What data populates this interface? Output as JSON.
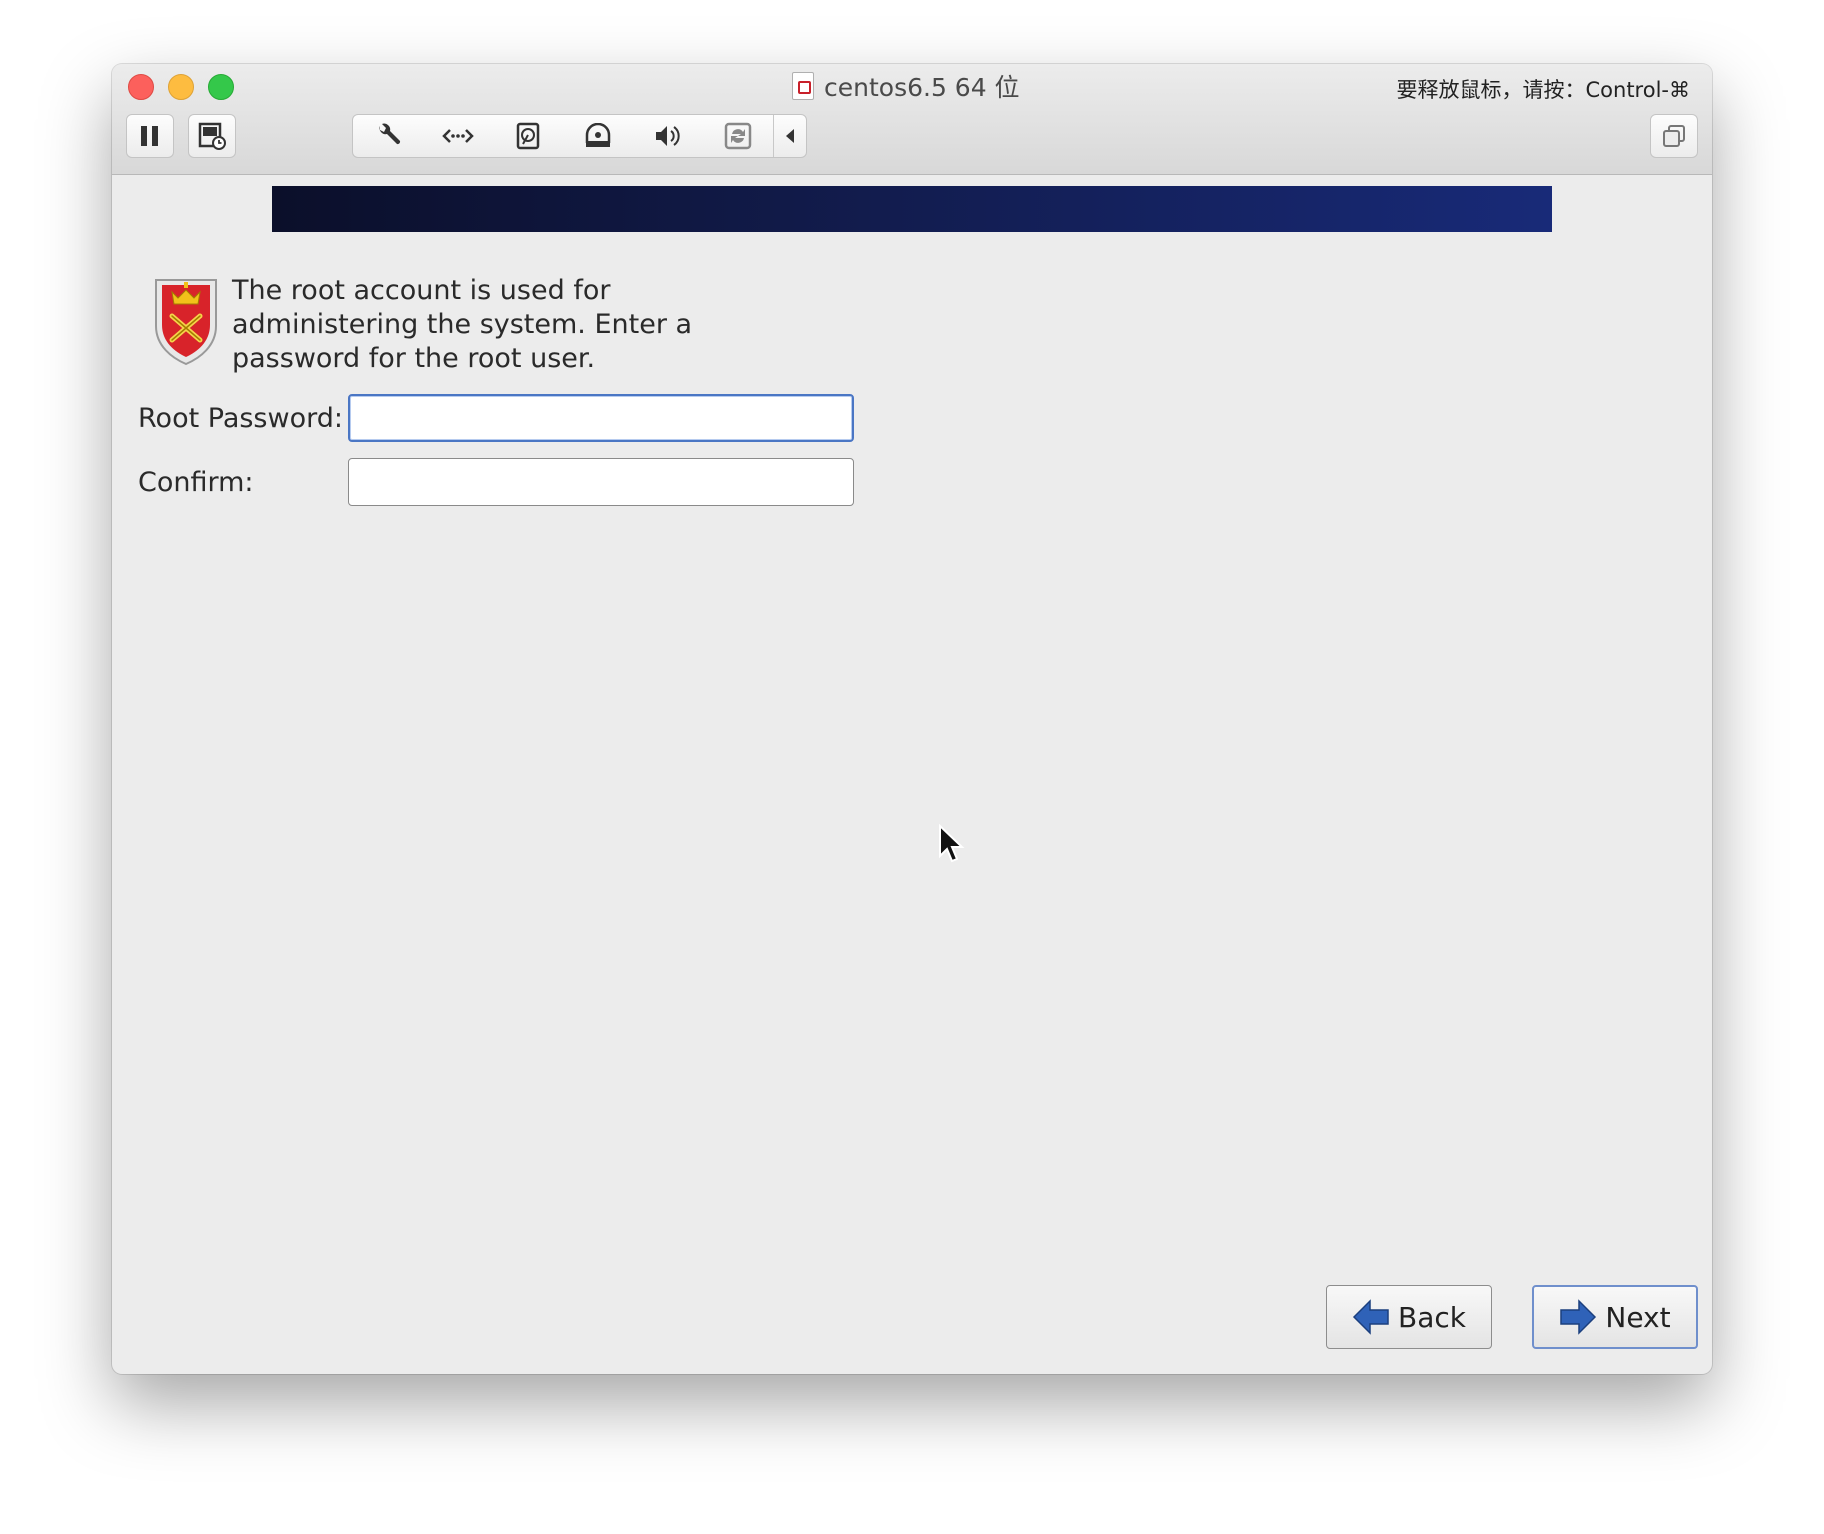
{
  "window": {
    "title": "centos6.5 64 位",
    "release_hint": "要释放鼠标，请按：Control-⌘"
  },
  "toolbar": {
    "icons": [
      "pause-icon",
      "snapshot-icon",
      "settings-wrench-icon",
      "network-icon",
      "hard-disk-icon",
      "cd-dvd-icon",
      "sound-icon",
      "usb-sync-icon",
      "collapse-arrow-icon",
      "fullscreen-icon"
    ]
  },
  "installer": {
    "intro_text": "The root account is used for administering the system.  Enter a password for the root user.",
    "root_password_label": "Root Password:",
    "root_password_value": "",
    "confirm_label": "Confirm:",
    "confirm_value": "",
    "back_label": "Back",
    "next_label": "Next"
  },
  "colors": {
    "banner_start": "#0b0f2a",
    "banner_end": "#182a78",
    "focus_border": "#4a76c4",
    "arrow_blue": "#2f62b8"
  }
}
